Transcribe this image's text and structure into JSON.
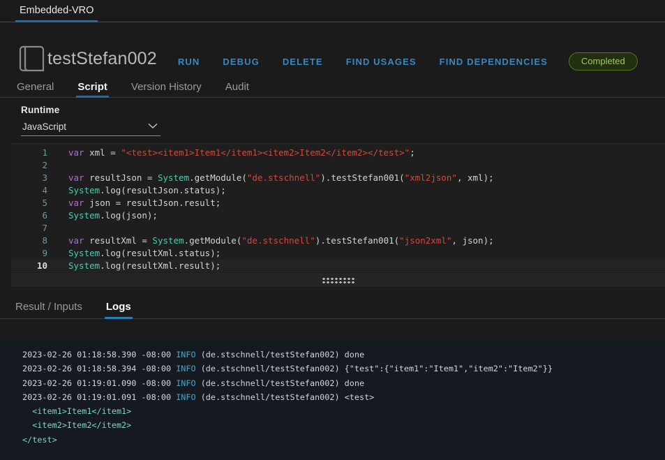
{
  "browser": {
    "tabs": [
      {
        "label": "Embedded-VRO",
        "active": true
      }
    ]
  },
  "header": {
    "icon": "script-document-icon",
    "object_name": "testStefan002",
    "actions": [
      {
        "label": "RUN",
        "name": "run-action"
      },
      {
        "label": "DEBUG",
        "name": "debug-action"
      },
      {
        "label": "DELETE",
        "name": "delete-action"
      },
      {
        "label": "FIND USAGES",
        "name": "find-usages-action"
      },
      {
        "label": "FIND DEPENDENCIES",
        "name": "find-dependencies-action"
      }
    ],
    "status_badge": "Completed",
    "colors": {
      "action_link": "#3e87bd",
      "badge_text": "#9ccc5a",
      "badge_border": "#4b7a18",
      "badge_bg": "#22300f",
      "tab_underline": "#1a6fad"
    }
  },
  "subtabs": [
    {
      "label": "General",
      "active": false
    },
    {
      "label": "Script",
      "active": true
    },
    {
      "label": "Version History",
      "active": false
    },
    {
      "label": "Audit",
      "active": false
    }
  ],
  "runtime": {
    "label": "Runtime",
    "value": "JavaScript",
    "dropdown_icon": "chevron-down-icon"
  },
  "editor": {
    "lines": [
      {
        "num": "1",
        "current": false,
        "tokens": [
          {
            "t": "var ",
            "c": "kw"
          },
          {
            "t": "xml = ",
            "c": "plain"
          },
          {
            "t": "\"<test><item1>Item1</item1><item2>Item2</item2></test>\"",
            "c": "str"
          },
          {
            "t": ";",
            "c": "plain"
          }
        ]
      },
      {
        "num": "2",
        "current": false,
        "tokens": []
      },
      {
        "num": "3",
        "current": false,
        "tokens": [
          {
            "t": "var ",
            "c": "kw"
          },
          {
            "t": "resultJson = ",
            "c": "plain"
          },
          {
            "t": "System",
            "c": "cls"
          },
          {
            "t": ".getModule(",
            "c": "plain"
          },
          {
            "t": "\"de.stschnell\"",
            "c": "str"
          },
          {
            "t": ").testStefan001(",
            "c": "plain"
          },
          {
            "t": "\"xml2json\"",
            "c": "str"
          },
          {
            "t": ", xml);",
            "c": "plain"
          }
        ]
      },
      {
        "num": "4",
        "current": false,
        "tokens": [
          {
            "t": "System",
            "c": "cls"
          },
          {
            "t": ".log(resultJson.status);",
            "c": "plain"
          }
        ]
      },
      {
        "num": "5",
        "current": false,
        "tokens": [
          {
            "t": "var ",
            "c": "kw"
          },
          {
            "t": "json = resultJson.result;",
            "c": "plain"
          }
        ]
      },
      {
        "num": "6",
        "current": false,
        "tokens": [
          {
            "t": "System",
            "c": "cls"
          },
          {
            "t": ".log(json);",
            "c": "plain"
          }
        ]
      },
      {
        "num": "7",
        "current": false,
        "tokens": []
      },
      {
        "num": "8",
        "current": false,
        "tokens": [
          {
            "t": "var ",
            "c": "kw"
          },
          {
            "t": "resultXml = ",
            "c": "plain"
          },
          {
            "t": "System",
            "c": "cls"
          },
          {
            "t": ".getModule(",
            "c": "plain"
          },
          {
            "t": "\"de.stschnell\"",
            "c": "str"
          },
          {
            "t": ").testStefan001(",
            "c": "plain"
          },
          {
            "t": "\"json2xml\"",
            "c": "str"
          },
          {
            "t": ", json);",
            "c": "plain"
          }
        ]
      },
      {
        "num": "9",
        "current": false,
        "tokens": [
          {
            "t": "System",
            "c": "cls"
          },
          {
            "t": ".log(resultXml.status);",
            "c": "plain"
          }
        ]
      },
      {
        "num": "10",
        "current": true,
        "tokens": [
          {
            "t": "System",
            "c": "cls"
          },
          {
            "t": ".log(resultXml.result);",
            "c": "plain"
          }
        ]
      }
    ],
    "resizer_icon": "drag-grip-icon"
  },
  "bottomtabs": [
    {
      "label": "Result / Inputs",
      "active": false
    },
    {
      "label": "Logs",
      "active": true
    }
  ],
  "logs": {
    "entries": [
      {
        "timestamp": "2023-02-26 01:18:58.390 -08:00",
        "level": "INFO",
        "source": "(de.stschnell/testStefan002)",
        "message": "done"
      },
      {
        "timestamp": "2023-02-26 01:18:58.394 -08:00",
        "level": "INFO",
        "source": "(de.stschnell/testStefan002)",
        "message": "{\"test\":{\"item1\":\"Item1\",\"item2\":\"Item2\"}}"
      },
      {
        "timestamp": "2023-02-26 01:19:01.090 -08:00",
        "level": "INFO",
        "source": "(de.stschnell/testStefan002)",
        "message": "done"
      },
      {
        "timestamp": "2023-02-26 01:19:01.091 -08:00",
        "level": "INFO",
        "source": "(de.stschnell/testStefan002)",
        "message": "<test>"
      }
    ],
    "continuation_lines": [
      "  <item1>Item1</item1>",
      "  <item2>Item2</item2>",
      "</test>"
    ]
  }
}
